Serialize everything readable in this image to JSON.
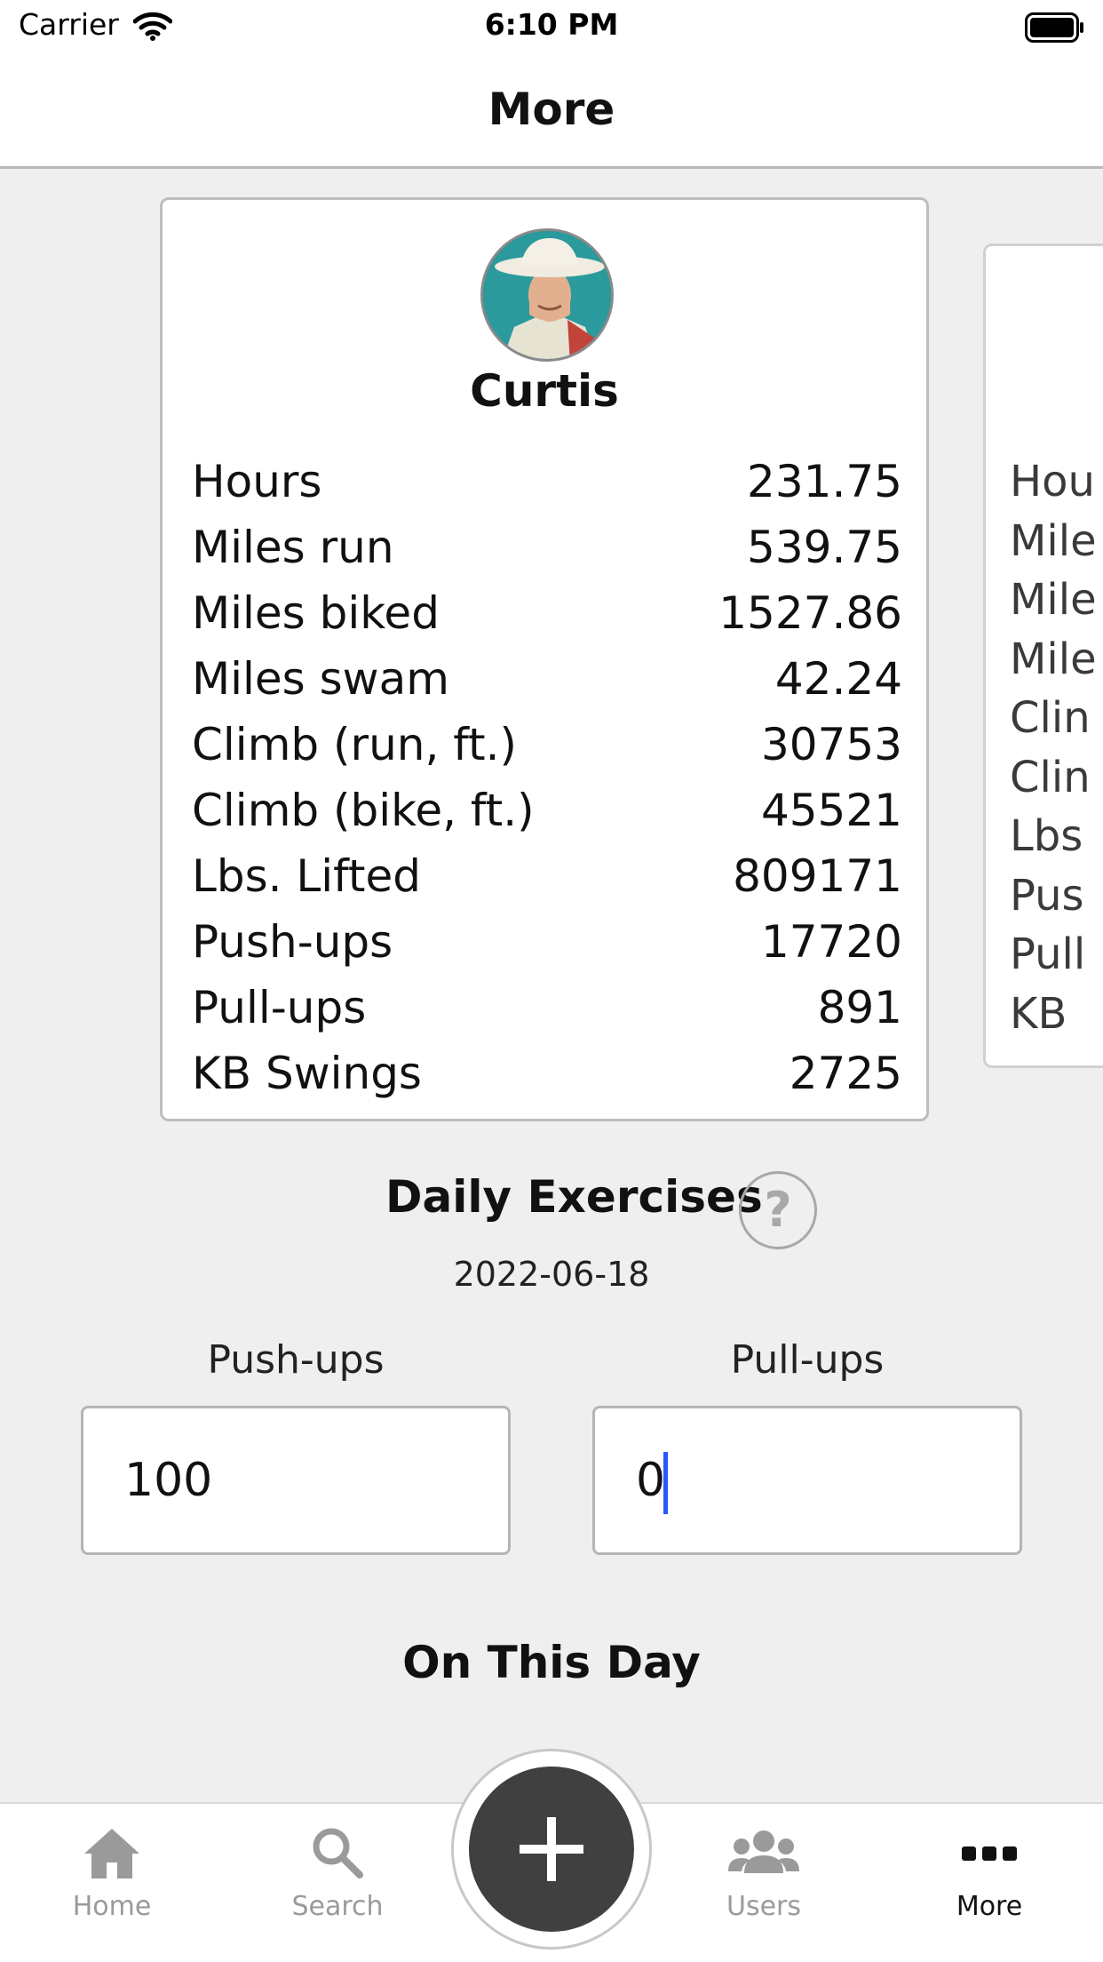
{
  "status_bar": {
    "carrier": "Carrier",
    "time": "6:10 PM"
  },
  "nav": {
    "title": "More"
  },
  "profile": {
    "name": "Curtis",
    "stats": [
      {
        "label": "Hours",
        "value": "231.75"
      },
      {
        "label": "Miles run",
        "value": "539.75"
      },
      {
        "label": "Miles biked",
        "value": "1527.86"
      },
      {
        "label": "Miles swam",
        "value": "42.24"
      },
      {
        "label": "Climb (run, ft.)",
        "value": "30753"
      },
      {
        "label": "Climb (bike, ft.)",
        "value": "45521"
      },
      {
        "label": "Lbs. Lifted",
        "value": "809171"
      },
      {
        "label": "Push-ups",
        "value": "17720"
      },
      {
        "label": "Pull-ups",
        "value": "891"
      },
      {
        "label": "KB Swings",
        "value": "2725"
      }
    ]
  },
  "next_card": {
    "labels": [
      "Hou",
      "Mile",
      "Mile",
      "Mile",
      "Clin",
      "Clin",
      "Lbs",
      "Pus",
      "Pull",
      "KB"
    ]
  },
  "daily": {
    "title": "Daily Exercises",
    "help_symbol": "?",
    "date": "2022-06-18",
    "pushups_label": "Push-ups",
    "pushups_value": "100",
    "pullups_label": "Pull-ups",
    "pullups_value": "0"
  },
  "on_this_day": {
    "title": "On This Day"
  },
  "tabs": [
    {
      "label": "Home",
      "icon": "home-icon",
      "active": false
    },
    {
      "label": "Search",
      "icon": "search-icon",
      "active": false
    },
    {
      "label": "Users",
      "icon": "users-icon",
      "active": false
    },
    {
      "label": "More",
      "icon": "more-icon",
      "active": true
    }
  ],
  "colors": {
    "accent_dark": "#404040",
    "inactive_tab": "#9a9a9a",
    "cursor": "#2b55ff"
  }
}
